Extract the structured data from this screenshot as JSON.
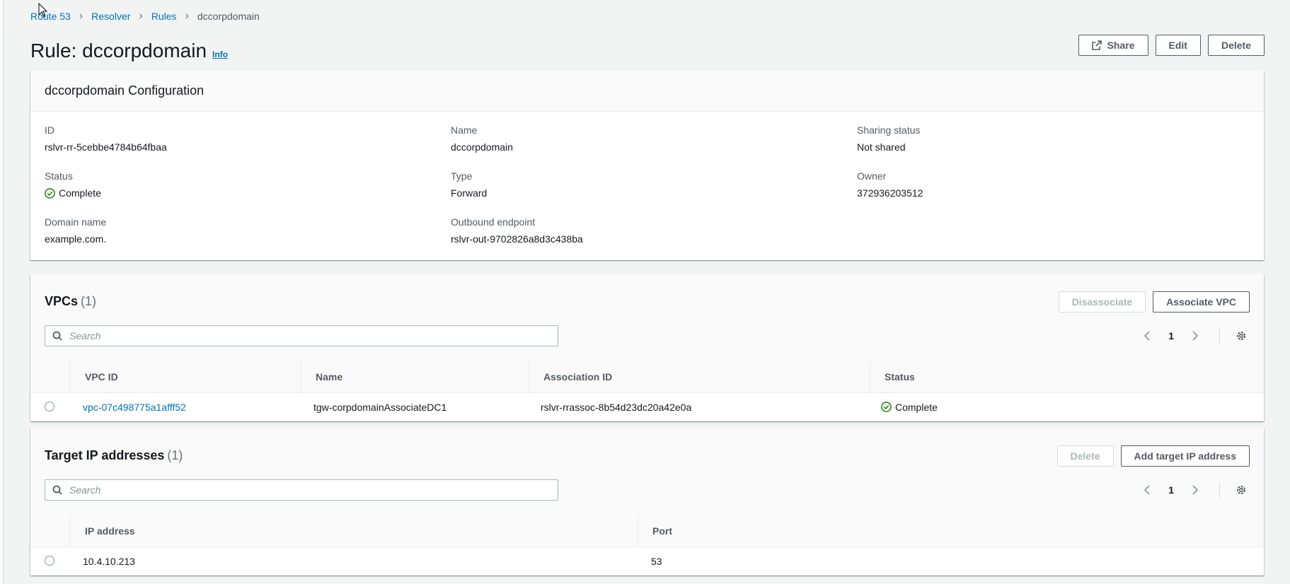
{
  "breadcrumb": [
    {
      "label": "Route 53"
    },
    {
      "label": "Resolver"
    },
    {
      "label": "Rules"
    },
    {
      "label": "dccorpdomain"
    }
  ],
  "page": {
    "title": "Rule: dccorpdomain",
    "info": "Info",
    "share_label": "Share",
    "edit_label": "Edit",
    "delete_label": "Delete"
  },
  "config": {
    "header": "dccorpdomain Configuration",
    "id_label": "ID",
    "id_value": "rslvr-rr-5cebbe4784b64fbaa",
    "name_label": "Name",
    "name_value": "dccorpdomain",
    "sharing_label": "Sharing status",
    "sharing_value": "Not shared",
    "status_label": "Status",
    "status_value": "Complete",
    "type_label": "Type",
    "type_value": "Forward",
    "owner_label": "Owner",
    "owner_value": "372936203512",
    "domain_label": "Domain name",
    "domain_value": "example.com.",
    "outbound_label": "Outbound endpoint",
    "outbound_value": "rslvr-out-9702826a8d3c438ba"
  },
  "vpcs": {
    "title": "VPCs",
    "count": "(1)",
    "disassociate_label": "Disassociate",
    "associate_label": "Associate VPC",
    "search_placeholder": "Search",
    "page": "1",
    "columns": [
      "VPC ID",
      "Name",
      "Association ID",
      "Status"
    ],
    "rows": [
      {
        "vpc_id": "vpc-07c498775a1afff52",
        "name": "tgw-corpdomainAssociateDC1",
        "association_id": "rslvr-rrassoc-8b54d23dc20a42e0a",
        "status": "Complete"
      }
    ]
  },
  "targets": {
    "title": "Target IP addresses",
    "count": "(1)",
    "delete_label": "Delete",
    "add_label": "Add target IP address",
    "search_placeholder": "Search",
    "page": "1",
    "columns": [
      "IP address",
      "Port"
    ],
    "rows": [
      {
        "ip": "10.4.10.213",
        "port": "53"
      }
    ]
  },
  "colors": {
    "link": "#0073bb",
    "success": "#1d8102",
    "background": "#f2f3f3"
  }
}
